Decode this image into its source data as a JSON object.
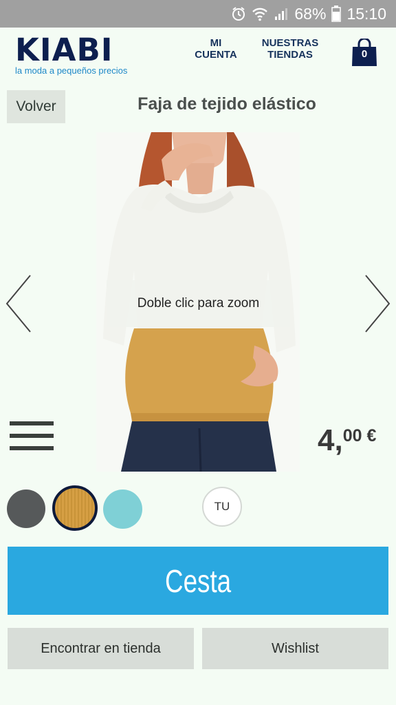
{
  "status_bar": {
    "battery": "68%",
    "time": "15:10",
    "icons": [
      "alarm-icon",
      "wifi-icon",
      "signal-icon",
      "battery-icon"
    ]
  },
  "header": {
    "logo_word": "KIABI",
    "logo_tagline": "la moda a pequeños precios",
    "account_line1": "MI",
    "account_line2": "CUENTA",
    "stores_line1": "NUESTRAS",
    "stores_line2": "TIENDAS",
    "cart_count": "0"
  },
  "product": {
    "back_label": "Volver",
    "title": "Faja de tejido elástico",
    "zoom_hint": "Doble clic para zoom",
    "price_integer": "4,",
    "price_decimal": "00 €",
    "colors": [
      {
        "name": "grey",
        "hex": "#56595a"
      },
      {
        "name": "mustard",
        "hex": "#d69f44",
        "selected": true
      },
      {
        "name": "aqua",
        "hex": "#7fd0d6"
      }
    ],
    "size_label": "TU"
  },
  "actions": {
    "cart_button": "Cesta",
    "find_store_button": "Encontrar en tienda",
    "wishlist_button": "Wishlist"
  },
  "theme": {
    "brand_navy": "#0d1f4f",
    "accent_blue": "#2aa8e0",
    "background": "#f4fcf4"
  }
}
